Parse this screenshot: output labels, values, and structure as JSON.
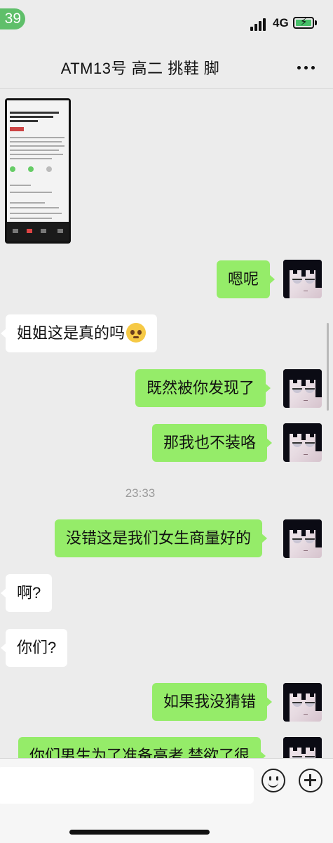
{
  "status_bar": {
    "time": "39",
    "network": "4G"
  },
  "header": {
    "title": "ATM13号 高二 挑鞋 脚"
  },
  "messages": [
    {
      "side": "out",
      "text": "嗯呢"
    },
    {
      "side": "in",
      "text": "姐姐这是真的吗"
    },
    {
      "side": "out",
      "text": "既然被你发现了"
    },
    {
      "side": "out",
      "text": "那我也不装咯"
    },
    {
      "side": "out",
      "text": "没错这是我们女生商量好的"
    },
    {
      "side": "in",
      "text": "啊?"
    },
    {
      "side": "in",
      "text": "你们?"
    },
    {
      "side": "out",
      "text": "如果我没猜错"
    },
    {
      "side": "out",
      "text": "你们男生为了准备高考 禁欲了很"
    }
  ],
  "timestamp": "23:33",
  "input": {
    "placeholder": ""
  },
  "colors": {
    "sent_bubble": "#95ec69",
    "received_bubble": "#ffffff",
    "background": "#ececec"
  },
  "icons": {
    "more": "more-dots-icon",
    "emoji": "smiley-icon",
    "add": "plus-circle-icon"
  }
}
